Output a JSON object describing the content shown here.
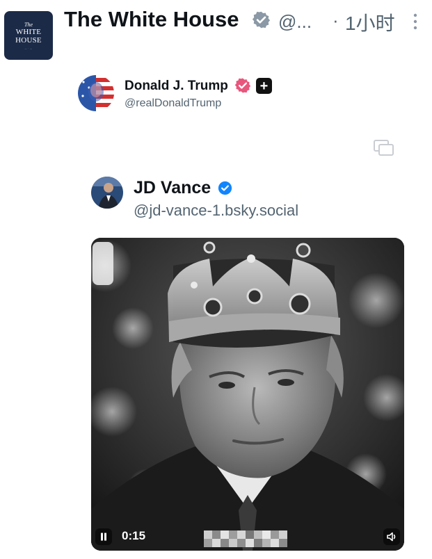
{
  "post": {
    "account_name": "The White House",
    "handle": "@...",
    "separator": "·",
    "time": "1小时",
    "avatar_logo": {
      "line1": "The",
      "line2": "WHITE",
      "line3": "HOUSE"
    },
    "verified_icon": "verified-badge-gray-icon",
    "more_icon": "more-vertical-icon"
  },
  "quoted": {
    "name": "Donald J. Trump",
    "handle": "@realDonaldTrump",
    "verified_icon": "verified-badge-pink-icon",
    "badge_plus": "+"
  },
  "media_icon": "cross-post-media-icon",
  "nested_post": {
    "name": "JD Vance",
    "handle": "@jd-vance-1.bsky.social",
    "verified_icon": "verified-badge-blue-icon"
  },
  "video": {
    "elapsed": "0:15",
    "pause_icon": "pause-icon",
    "volume_icon": "volume-icon"
  },
  "colors": {
    "text_primary": "#0f1419",
    "text_secondary": "#536471",
    "verified_gray": "#8b98a5",
    "verified_pink": "#e8567d",
    "verified_blue": "#1185fe",
    "avatar_navy": "#1b2a47"
  }
}
